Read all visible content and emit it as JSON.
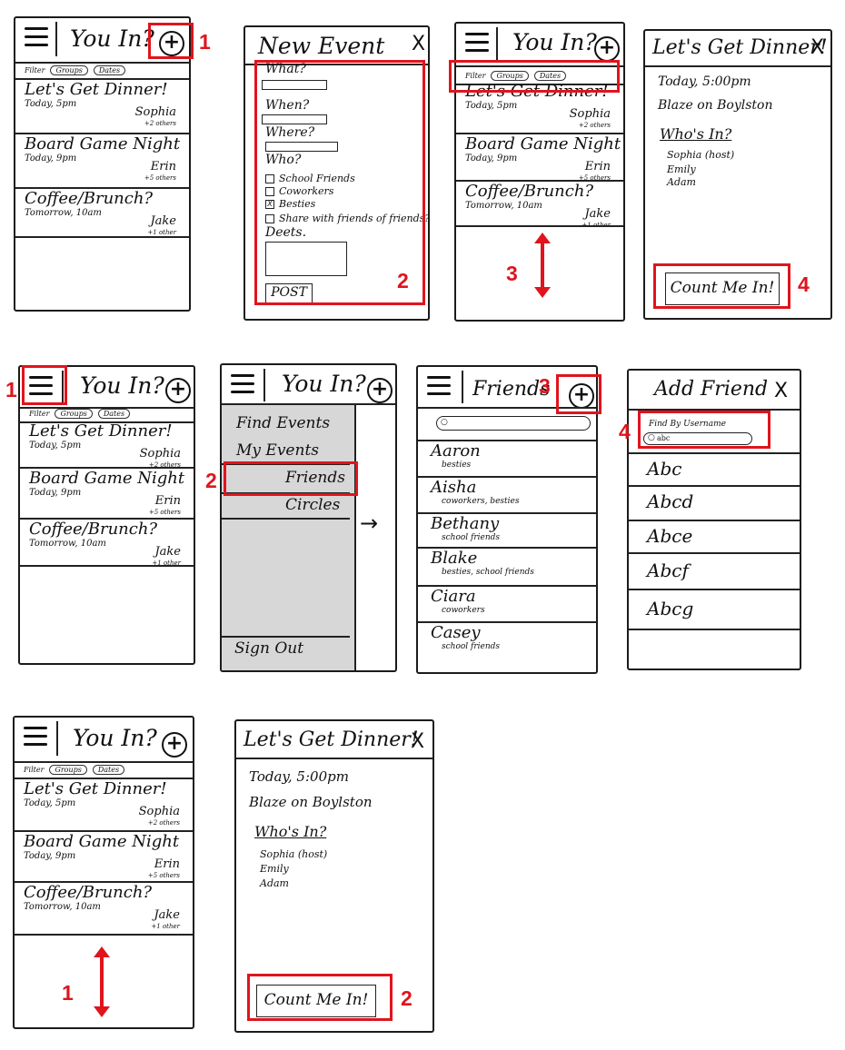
{
  "feed": {
    "app_title": "You In?",
    "filter_label": "Filter",
    "pill_1": "Groups",
    "pill_2": "Dates",
    "events": [
      {
        "name": "Let's Get Dinner!",
        "when": "Today, 5pm",
        "host": "Sophia",
        "others": "+2 others"
      },
      {
        "name": "Board Game Night",
        "when": "Today, 9pm",
        "host": "Erin",
        "others": "+5 others"
      },
      {
        "name": "Coffee/Brunch?",
        "when": "Tomorrow, 10am",
        "host": "Jake",
        "others": "+1 other"
      }
    ]
  },
  "new_event": {
    "title": "New Event",
    "close": "X",
    "what": "What?",
    "when": "When?",
    "where": "Where?",
    "who": "Who?",
    "options": [
      {
        "label": "School Friends",
        "checked": ""
      },
      {
        "label": "Coworkers",
        "checked": ""
      },
      {
        "label": "Besties",
        "checked": "X"
      }
    ],
    "share": "Share with friends of friends?",
    "deets": "Deets.",
    "post": "POST"
  },
  "detail": {
    "title": "Let's Get Dinner!",
    "close": "X",
    "time": "Today, 5:00pm",
    "place": "Blaze on Boylston",
    "whos_in": "Who's In?",
    "attendees": [
      "Sophia (host)",
      "Emily",
      "Adam"
    ],
    "count_me_in": "Count Me In!"
  },
  "menu": {
    "items": [
      "Find Events",
      "My Events",
      "Friends",
      "Circles"
    ],
    "sign_out": "Sign Out",
    "arrow": "→"
  },
  "friends": {
    "title": "Friends",
    "list": [
      {
        "name": "Aaron",
        "tag": "besties"
      },
      {
        "name": "Aisha",
        "tag": "coworkers, besties"
      },
      {
        "name": "Bethany",
        "tag": "school friends"
      },
      {
        "name": "Blake",
        "tag": "besties, school friends"
      },
      {
        "name": "Ciara",
        "tag": "coworkers"
      },
      {
        "name": "Casey",
        "tag": "school friends"
      }
    ]
  },
  "add_friend": {
    "title": "Add Friend",
    "close": "X",
    "find_label": "Find By Username",
    "search_value": "abc",
    "results": [
      "Abc",
      "Abcd",
      "Abce",
      "Abcf",
      "Abcg"
    ]
  },
  "step_labels": {
    "r1": [
      "1",
      "2",
      "3",
      "4"
    ],
    "r2": [
      "1",
      "2",
      "3",
      "4"
    ],
    "r3": [
      "1",
      "2"
    ]
  },
  "colors": {
    "annotation": "#e0141d",
    "menu_panel": "#d7d7d7"
  }
}
